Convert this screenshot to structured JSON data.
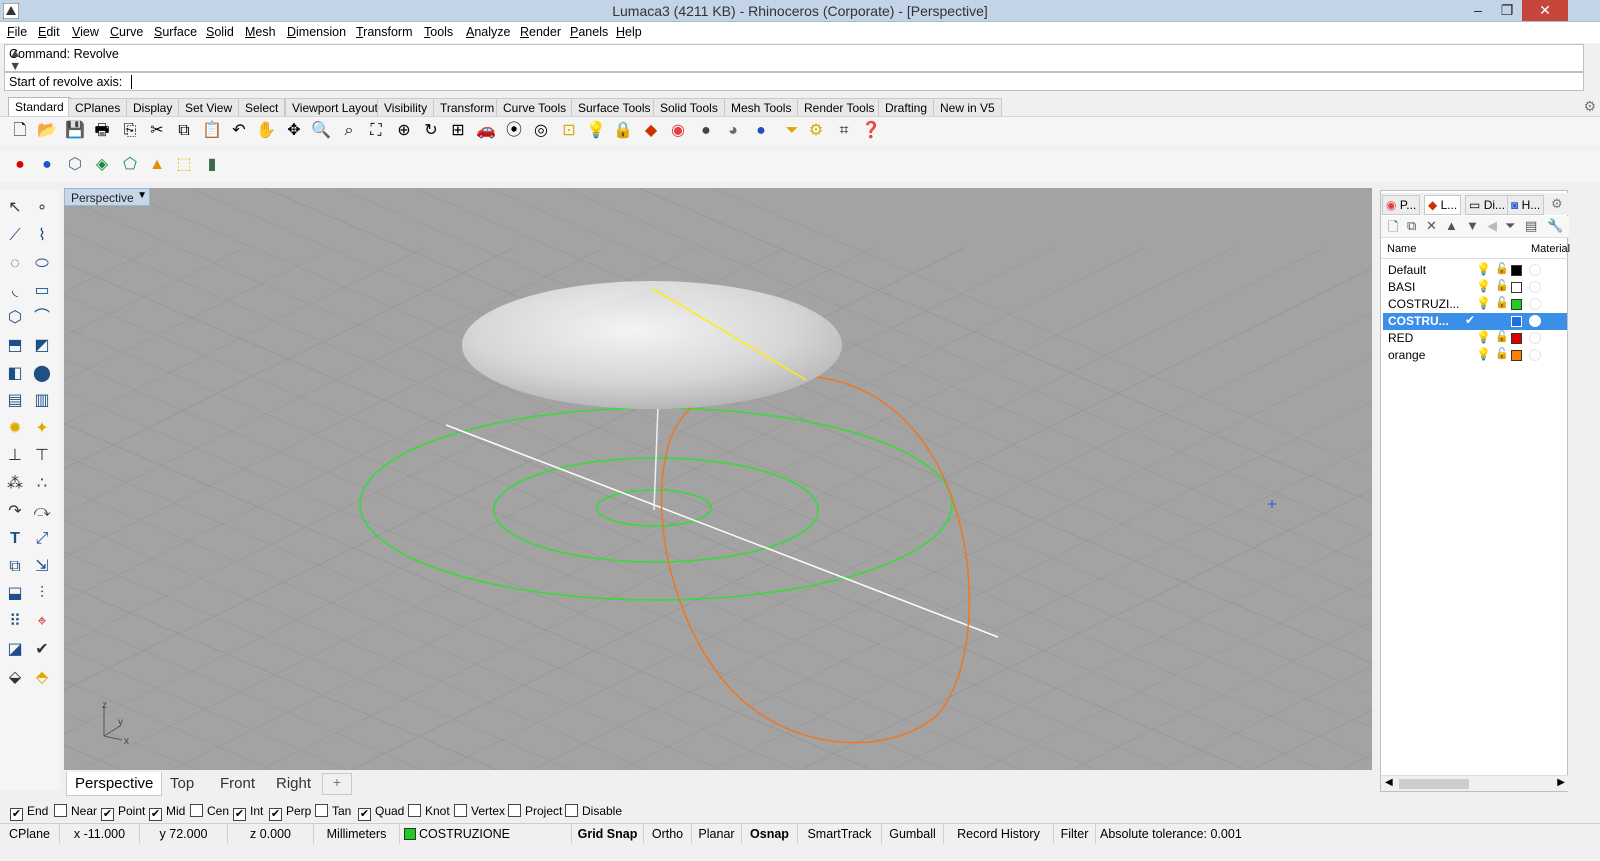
{
  "window": {
    "title": "Lumaca3 (4211 KB) - Rhinoceros (Corporate) - [Perspective]",
    "min": "–",
    "max": "❐",
    "close": "✕"
  },
  "menu": [
    "File",
    "Edit",
    "View",
    "Curve",
    "Surface",
    "Solid",
    "Mesh",
    "Dimension",
    "Transform",
    "Tools",
    "Analyze",
    "Render",
    "Panels",
    "Help"
  ],
  "command": {
    "history": "Command: Revolve",
    "prompt": "Start of revolve axis:"
  },
  "toolbar_tabs": [
    "Standard",
    "CPlanes",
    "Display",
    "Set View",
    "Select",
    "Viewport Layout",
    "Visibility",
    "Transform",
    "Curve Tools",
    "Surface Tools",
    "Solid Tools",
    "Mesh Tools",
    "Render Tools",
    "Drafting",
    "New in V5"
  ],
  "viewport": {
    "title": "Perspective",
    "axes": {
      "z": "z",
      "y": "y",
      "x": "x"
    }
  },
  "viewport_tabs": [
    "Perspective",
    "Top",
    "Front",
    "Right"
  ],
  "viewport_tab_add": "+",
  "panel_tabs": [
    "P...",
    "L...",
    "Di...",
    "H..."
  ],
  "layers": {
    "columns": {
      "name": "Name",
      "material": "Material"
    },
    "rows": [
      {
        "name": "Default",
        "color": "#000000",
        "current": false,
        "selected": false
      },
      {
        "name": "BASI",
        "color": "#ffffff",
        "current": false,
        "selected": false
      },
      {
        "name": "COSTRUZI...",
        "color": "#22cc22",
        "current": false,
        "selected": false
      },
      {
        "name": "COSTRU...",
        "color": "#1f6fe0",
        "current": true,
        "selected": true
      },
      {
        "name": "RED",
        "color": "#e00000",
        "current": false,
        "selected": false
      },
      {
        "name": "orange",
        "color": "#ff8000",
        "current": false,
        "selected": false
      }
    ],
    "check_mark": "✔"
  },
  "osnaps": [
    {
      "label": "End",
      "checked": true
    },
    {
      "label": "Near",
      "checked": false
    },
    {
      "label": "Point",
      "checked": true
    },
    {
      "label": "Mid",
      "checked": true
    },
    {
      "label": "Cen",
      "checked": false
    },
    {
      "label": "Int",
      "checked": true
    },
    {
      "label": "Perp",
      "checked": true
    },
    {
      "label": "Tan",
      "checked": false
    },
    {
      "label": "Quad",
      "checked": true
    },
    {
      "label": "Knot",
      "checked": false
    },
    {
      "label": "Vertex",
      "checked": false
    },
    {
      "label": "Project",
      "checked": false
    },
    {
      "label": "Disable",
      "checked": false
    }
  ],
  "status": {
    "cplane": "CPlane",
    "x": "x -11.000",
    "y": "y 72.000",
    "z": "z 0.000",
    "units": "Millimeters",
    "layer": "COSTRUZIONE",
    "layer_color": "#22cc22",
    "grid_snap": "Grid Snap",
    "ortho": "Ortho",
    "planar": "Planar",
    "osnap": "Osnap",
    "smarttrack": "SmartTrack",
    "gumball": "Gumball",
    "record_history": "Record History",
    "filter": "Filter",
    "tolerance": "Absolute tolerance: 0.001"
  },
  "colors": {
    "viewport_bg": "#a3a3a3",
    "grid": "#999999",
    "green_curve": "#33dd33",
    "orange_curve": "#ee7722",
    "axis_line": "#ffffff",
    "seam": "#ffee00",
    "selection": "#3b8fe8"
  }
}
